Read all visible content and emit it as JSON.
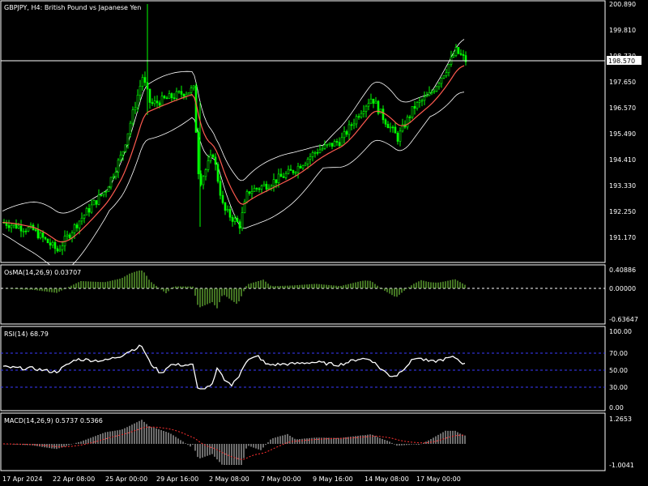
{
  "main_chart": {
    "symbol_title": "GBPJPY, H4:  British Pound vs Japanese Yen",
    "price_axis": [
      "200.890",
      "199.810",
      "198.730",
      "197.650",
      "196.570",
      "195.490",
      "194.410",
      "193.330",
      "192.250",
      "191.170"
    ],
    "current_price": "198.570",
    "candle_color": "#00ff00",
    "bollinger_color": "#ffffff",
    "ma_color": "#ff5a4f"
  },
  "osma": {
    "label": "OsMA(14,26,9) 0.03707",
    "axis": [
      "0.40886",
      "0.00000",
      "-0.63647"
    ],
    "bar_color": "#6fbf3a"
  },
  "rsi": {
    "label": "RSI(14) 68.79",
    "axis": [
      "100.00",
      "70.00",
      "50.00",
      "30.00",
      "0.00"
    ],
    "line_color": "#ffffff",
    "level_color": "#3a3aff"
  },
  "macd": {
    "label": "MACD(14,26,9) 0.5737 0.5366",
    "axis": [
      "1.2653",
      "-1.0041"
    ],
    "hist_color": "#d8d8d8",
    "signal_color": "#ff3030"
  },
  "time_axis": [
    "17 Apr 2024",
    "22 Apr 08:00",
    "25 Apr 00:00",
    "29 Apr 16:00",
    "2 May 08:00",
    "7 May 00:00",
    "9 May 16:00",
    "14 May 08:00",
    "17 May 00:00"
  ],
  "chart_data": {
    "type": "line",
    "title": "GBPJPY, H4:  British Pound vs Japanese Yen",
    "x": [
      "17 Apr 2024",
      "22 Apr 08:00",
      "25 Apr 00:00",
      "29 Apr 16:00",
      "2 May 08:00",
      "7 May 00:00",
      "9 May 16:00",
      "14 May 08:00",
      "17 May 00:00"
    ],
    "series": [
      {
        "name": "",
        "values": [
          192.3,
          191.5,
          193.8,
          197.0,
          193.5,
          193.4,
          195.2,
          196.8,
          198.2
        ]
      }
    ],
    "ylim": [
      190.8,
      200.9
    ],
    "grid": false,
    "legend": "none"
  }
}
